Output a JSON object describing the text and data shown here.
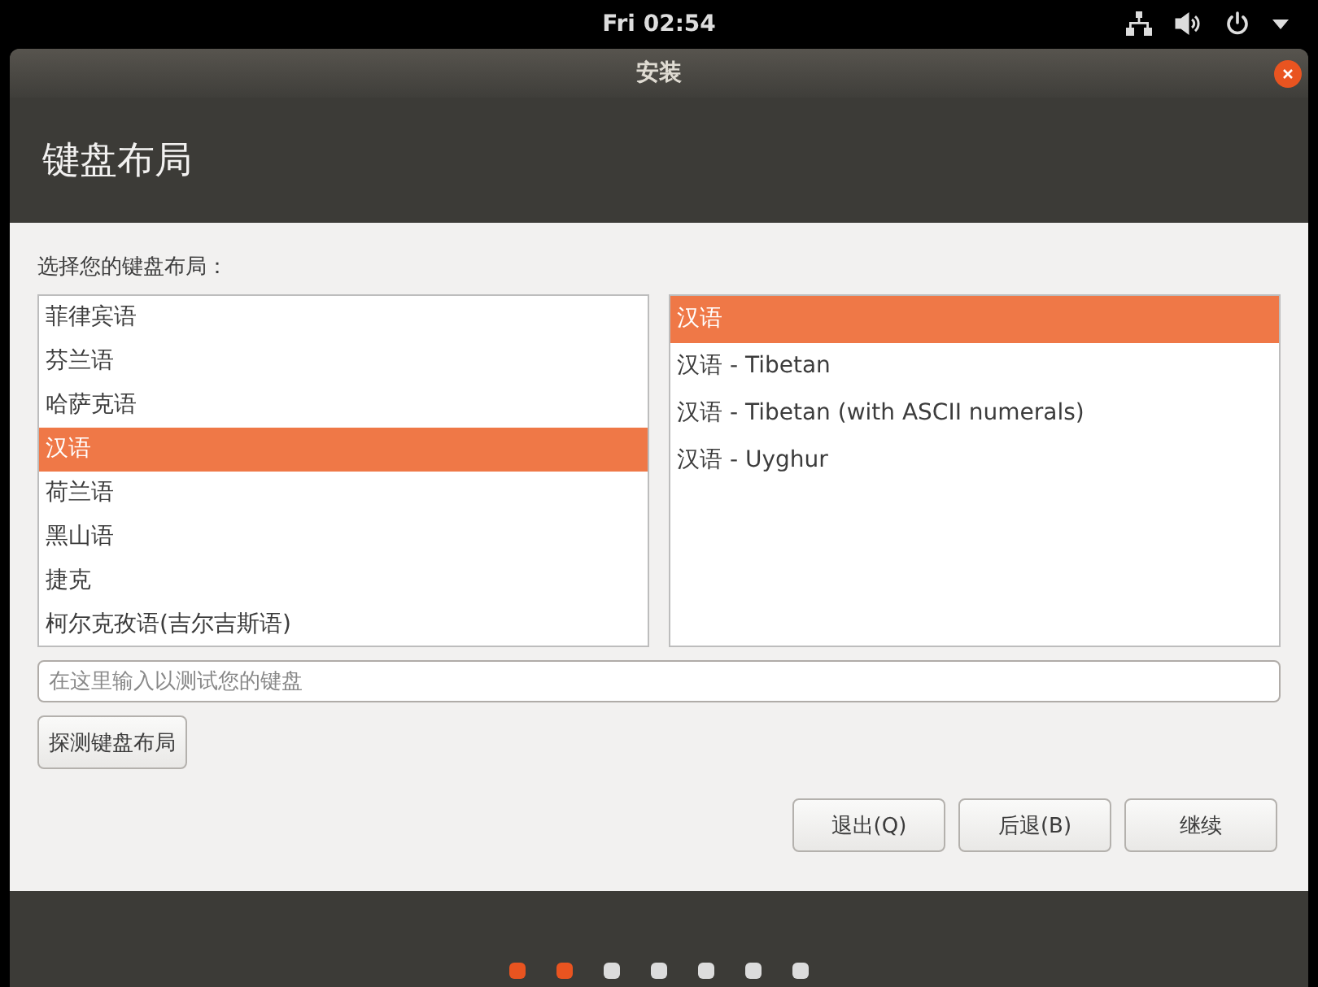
{
  "top_bar": {
    "clock": "Fri 02:54"
  },
  "window": {
    "title": "安装"
  },
  "header": {
    "title": "键盘布局"
  },
  "prompt": "选择您的键盘布局：",
  "layouts": [
    {
      "label": "菲律宾语",
      "selected": false
    },
    {
      "label": "芬兰语",
      "selected": false
    },
    {
      "label": "哈萨克语",
      "selected": false
    },
    {
      "label": "汉语",
      "selected": true
    },
    {
      "label": "荷兰语",
      "selected": false
    },
    {
      "label": "黑山语",
      "selected": false
    },
    {
      "label": "捷克",
      "selected": false
    },
    {
      "label": "柯尔克孜语(吉尔吉斯语)",
      "selected": false
    }
  ],
  "variants": [
    {
      "label": "汉语",
      "selected": true
    },
    {
      "label": "汉语 - Tibetan",
      "selected": false
    },
    {
      "label": "汉语 - Tibetan (with ASCII numerals)",
      "selected": false
    },
    {
      "label": "汉语 - Uyghur",
      "selected": false
    }
  ],
  "test_field": {
    "placeholder": "在这里输入以测试您的键盘"
  },
  "detect_button": "探测键盘布局",
  "buttons": [
    "退出(Q)",
    "后退(B)",
    "继续"
  ],
  "progress": [
    {
      "done": true
    },
    {
      "done": true
    },
    {
      "done": false
    },
    {
      "done": false
    },
    {
      "done": false
    },
    {
      "done": false
    },
    {
      "done": false
    }
  ]
}
